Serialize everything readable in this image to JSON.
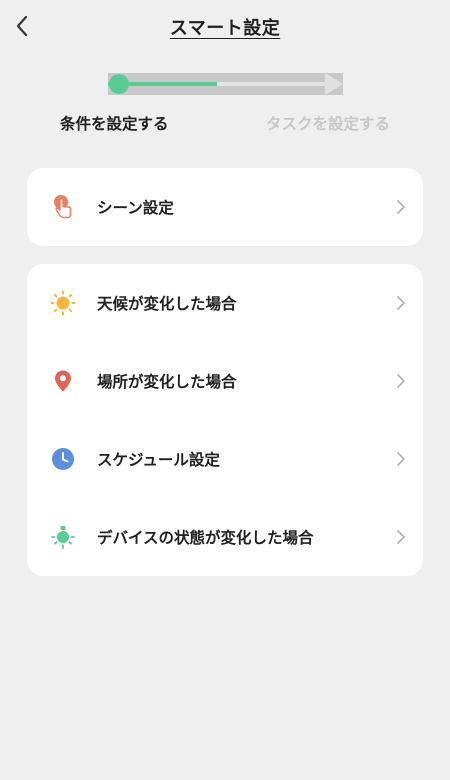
{
  "header": {
    "title": "スマート設定",
    "back_icon": "chevron-left-icon"
  },
  "progress": {
    "current_step": 1,
    "total_steps": 2,
    "fill_fraction": 0.5,
    "accent_color": "#5bcb95"
  },
  "steps": [
    {
      "label": "条件を設定する",
      "state": "active"
    },
    {
      "label": "タスクを設定する",
      "state": "inactive"
    }
  ],
  "scene_card": {
    "items": [
      {
        "label": "シーン設定",
        "icon": "tap-hand-icon"
      }
    ]
  },
  "conditions_card": {
    "items": [
      {
        "label": "天候が変化した場合",
        "icon": "sun-icon"
      },
      {
        "label": "場所が変化した場合",
        "icon": "location-pin-icon"
      },
      {
        "label": "スケジュール設定",
        "icon": "clock-icon"
      },
      {
        "label": "デバイスの状態が変化した場合",
        "icon": "device-bulb-icon"
      }
    ]
  },
  "colors": {
    "background": "#efefef",
    "card": "#ffffff",
    "inactive_text": "#c7c7c7",
    "hand_icon": "#ee7e63",
    "sun_icon": "#f5b63d",
    "pin_icon": "#e0635a",
    "clock_icon": "#5b8fde",
    "device_icon": "#5bcb95"
  }
}
